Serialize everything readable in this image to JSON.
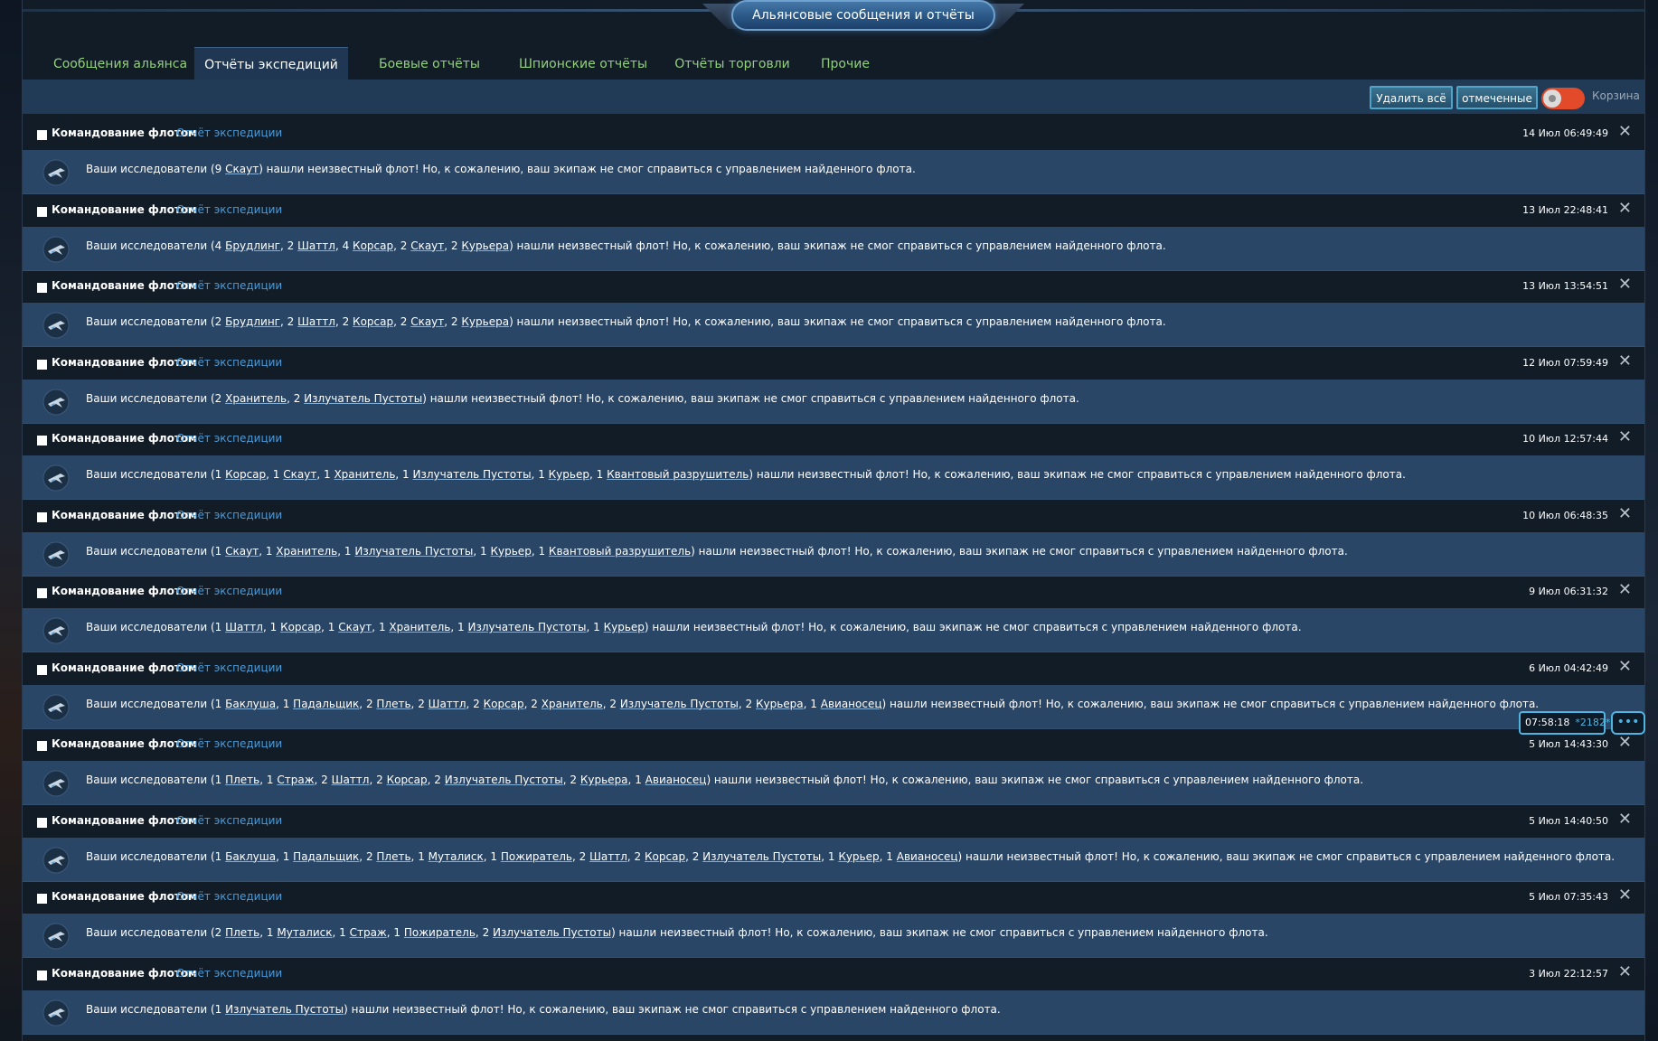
{
  "window": {
    "title": "Альянсовые сообщения и отчёты"
  },
  "tabs": [
    {
      "label": "Сообщения альянса",
      "active": false
    },
    {
      "label": "Отчёты экспедиций",
      "active": true
    },
    {
      "label": "Боевые отчёты",
      "active": false
    },
    {
      "label": "Шпионские отчёты",
      "active": false
    },
    {
      "label": "Отчёты торговли",
      "active": false
    },
    {
      "label": "Прочие",
      "active": false
    }
  ],
  "toolbar": {
    "delete_all": "Удалить всё",
    "marked": "отмеченные",
    "trash_label": "Корзина",
    "trash_toggle": "on"
  },
  "colors": {
    "tab_text": "#93d07c",
    "subject_link": "#4d9ad6",
    "message_body_bg": "#2a4666",
    "toggle_on": "#e24a2a",
    "accent_button": "#4fa4c8"
  },
  "message_text": {
    "prefix": "Ваши исследователи (",
    "suffix": ") нашли неизвестный флот! Но, к сожалению, ваш экипаж не смог справиться с управлением найденного флота."
  },
  "messages": [
    {
      "sender": "Командование флотом",
      "subject": "Отчёт экспедиции",
      "date": "14 Июл 06:49:49",
      "icon": "ship-icon",
      "ships": [
        {
          "n": "9",
          "name": "Скаут"
        }
      ]
    },
    {
      "sender": "Командование флотом",
      "subject": "Отчёт экспедиции",
      "date": "13 Июл 22:48:41",
      "icon": "ship-icon",
      "ships": [
        {
          "n": "4",
          "name": "Брудлинг"
        },
        {
          "n": "2",
          "name": "Шаттл"
        },
        {
          "n": "4",
          "name": "Корсар"
        },
        {
          "n": "2",
          "name": "Скаут"
        },
        {
          "n": "2",
          "name": "Курьера"
        }
      ]
    },
    {
      "sender": "Командование флотом",
      "subject": "Отчёт экспедиции",
      "date": "13 Июл 13:54:51",
      "icon": "ship-icon",
      "ships": [
        {
          "n": "2",
          "name": "Брудлинг"
        },
        {
          "n": "2",
          "name": "Шаттл"
        },
        {
          "n": "2",
          "name": "Корсар"
        },
        {
          "n": "2",
          "name": "Скаут"
        },
        {
          "n": "2",
          "name": "Курьера"
        }
      ]
    },
    {
      "sender": "Командование флотом",
      "subject": "Отчёт экспедиции",
      "date": "12 Июл 07:59:49",
      "icon": "ship-icon",
      "ships": [
        {
          "n": "2",
          "name": "Хранитель"
        },
        {
          "n": "2",
          "name": "Излучатель Пустоты"
        }
      ]
    },
    {
      "sender": "Командование флотом",
      "subject": "Отчёт экспедиции",
      "date": "10 Июл 12:57:44",
      "icon": "ship-icon",
      "ships": [
        {
          "n": "1",
          "name": "Корсар"
        },
        {
          "n": "1",
          "name": "Скаут"
        },
        {
          "n": "1",
          "name": "Хранитель"
        },
        {
          "n": "1",
          "name": "Излучатель Пустоты"
        },
        {
          "n": "1",
          "name": "Курьер"
        },
        {
          "n": "1",
          "name": "Квантовый разрушитель"
        }
      ]
    },
    {
      "sender": "Командование флотом",
      "subject": "Отчёт экспедиции",
      "date": "10 Июл 06:48:35",
      "icon": "ship-icon",
      "ships": [
        {
          "n": "1",
          "name": "Скаут"
        },
        {
          "n": "1",
          "name": "Хранитель"
        },
        {
          "n": "1",
          "name": "Излучатель Пустоты"
        },
        {
          "n": "1",
          "name": "Курьер"
        },
        {
          "n": "1",
          "name": "Квантовый разрушитель"
        }
      ]
    },
    {
      "sender": "Командование флотом",
      "subject": "Отчёт экспедиции",
      "date": "9 Июл 06:31:32",
      "icon": "ship-icon",
      "ships": [
        {
          "n": "1",
          "name": "Шаттл"
        },
        {
          "n": "1",
          "name": "Корсар"
        },
        {
          "n": "1",
          "name": "Скаут"
        },
        {
          "n": "1",
          "name": "Хранитель"
        },
        {
          "n": "1",
          "name": "Излучатель Пустоты"
        },
        {
          "n": "1",
          "name": "Курьер"
        }
      ]
    },
    {
      "sender": "Командование флотом",
      "subject": "Отчёт экспедиции",
      "date": "6 Июл 04:42:49",
      "icon": "ship-icon",
      "ships": [
        {
          "n": "1",
          "name": "Баклуша"
        },
        {
          "n": "1",
          "name": "Падальщик"
        },
        {
          "n": "2",
          "name": "Плеть"
        },
        {
          "n": "2",
          "name": "Шаттл"
        },
        {
          "n": "2",
          "name": "Корсар"
        },
        {
          "n": "2",
          "name": "Хранитель"
        },
        {
          "n": "2",
          "name": "Излучатель Пустоты"
        },
        {
          "n": "2",
          "name": "Курьера"
        },
        {
          "n": "1",
          "name": "Авианосец"
        }
      ]
    },
    {
      "sender": "Командование флотом",
      "subject": "Отчёт экспедиции",
      "date": "5 Июл 14:43:30",
      "icon": "ship-icon",
      "ships": [
        {
          "n": "1",
          "name": "Плеть"
        },
        {
          "n": "1",
          "name": "Страж"
        },
        {
          "n": "2",
          "name": "Шаттл"
        },
        {
          "n": "2",
          "name": "Корсар"
        },
        {
          "n": "2",
          "name": "Излучатель Пустоты"
        },
        {
          "n": "2",
          "name": "Курьера"
        },
        {
          "n": "1",
          "name": "Авианосец"
        }
      ]
    },
    {
      "sender": "Командование флотом",
      "subject": "Отчёт экспедиции",
      "date": "5 Июл 14:40:50",
      "icon": "ship-icon",
      "ships": [
        {
          "n": "1",
          "name": "Баклуша"
        },
        {
          "n": "1",
          "name": "Падальщик"
        },
        {
          "n": "2",
          "name": "Плеть"
        },
        {
          "n": "1",
          "name": "Муталиск"
        },
        {
          "n": "1",
          "name": "Пожиратель"
        },
        {
          "n": "2",
          "name": "Шаттл"
        },
        {
          "n": "2",
          "name": "Корсар"
        },
        {
          "n": "2",
          "name": "Излучатель Пустоты"
        },
        {
          "n": "1",
          "name": "Курьер"
        },
        {
          "n": "1",
          "name": "Авианосец"
        }
      ]
    },
    {
      "sender": "Командование флотом",
      "subject": "Отчёт экспедиции",
      "date": "5 Июл 07:35:43",
      "icon": "ship-icon",
      "ships": [
        {
          "n": "2",
          "name": "Плеть"
        },
        {
          "n": "1",
          "name": "Муталиск"
        },
        {
          "n": "1",
          "name": "Страж"
        },
        {
          "n": "1",
          "name": "Пожиратель"
        },
        {
          "n": "2",
          "name": "Излучатель Пустоты"
        }
      ]
    },
    {
      "sender": "Командование флотом",
      "subject": "Отчёт экспедиции",
      "date": "3 Июл 22:12:57",
      "icon": "ship-icon",
      "ships": [
        {
          "n": "1",
          "name": "Излучатель Пустоты"
        }
      ]
    }
  ],
  "overlay": {
    "time": "07:58:18",
    "counter": "*2182*",
    "chat_icon": "chat-icon"
  }
}
